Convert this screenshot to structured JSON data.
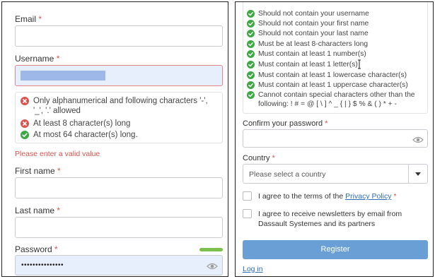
{
  "left_panel": {
    "email": {
      "label": "Email",
      "required_mark": "*",
      "value": ""
    },
    "username": {
      "label": "Username",
      "required_mark": "*",
      "value": "",
      "rules": [
        {
          "status": "error",
          "text": "Only alphanumerical and following characters '-', '_', '.' allowed"
        },
        {
          "status": "error",
          "text": "At least 8 character(s) long"
        },
        {
          "status": "ok",
          "text": "At most 64 character(s) long."
        }
      ],
      "error_message": "Please enter a valid value"
    },
    "first_name": {
      "label": "First name",
      "required_mark": "*",
      "value": ""
    },
    "last_name": {
      "label": "Last name",
      "required_mark": "*",
      "value": ""
    },
    "password": {
      "label": "Password",
      "required_mark": "*",
      "value": "•••••••••••••••",
      "strength_color": "#7cc04b"
    }
  },
  "right_panel": {
    "password_rules": [
      "Should not contain your username",
      "Should not contain your first name",
      "Should not contain your last name",
      "Must be at least 8-characters long",
      "Must contain at least 1 number(s)",
      "Must contain at least 1 letter(s)",
      "Must contain at least 1 lowercase character(s)",
      "Must contain at least 1 uppercase character(s)",
      "Cannot contain special characters other than the following: ! # = @ [ \\ ] ^ _ { | } $ % & ( ) * + -"
    ],
    "confirm_password": {
      "label": "Confirm your password",
      "required_mark": "*",
      "value": ""
    },
    "country": {
      "label": "Country",
      "required_mark": "*",
      "placeholder": "Please select a country"
    },
    "terms": {
      "prefix": "I agree to the terms of the",
      "link": "Privacy Policy",
      "required_mark": "*"
    },
    "newsletter": {
      "text": "I agree to receive newsletters by email from Dassault Systemes and its partners"
    },
    "register_label": "Register",
    "login_link": "Log in"
  },
  "colors": {
    "error": "#d9534f",
    "ok": "#3ea843",
    "button": "#6a9fd6",
    "link": "#2f6db5"
  }
}
